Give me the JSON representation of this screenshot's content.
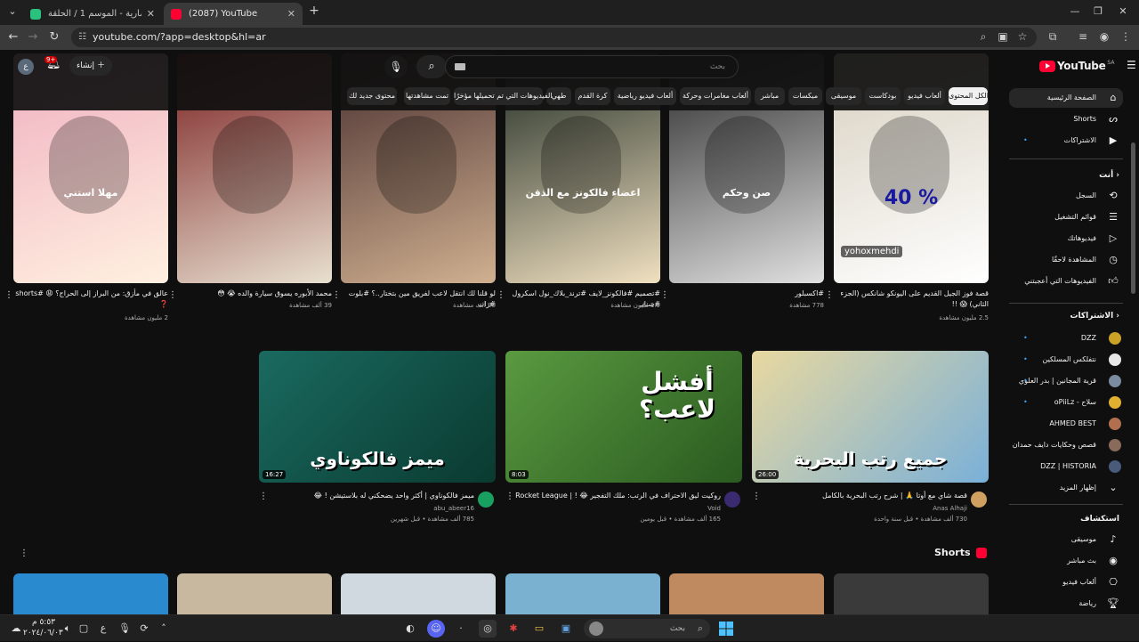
{
  "browser": {
    "tabs": [
      {
        "title": "شاهد الضارية - الموسم 1 / الحلقة",
        "active": false
      },
      {
        "title": "(2087) YouTube",
        "active": true
      }
    ],
    "new_tab": "+",
    "url": "youtube.com/?app=desktop&hl=ar"
  },
  "header": {
    "logo_text": "YouTube",
    "logo_region": "SA",
    "search_placeholder": "بحث",
    "create_label": "إنشاء",
    "notification_count": "9+",
    "avatar_letter": "ع"
  },
  "chips": [
    "الكل",
    "المحتوى",
    "ألعاب فيديو",
    "بودكاست",
    "موسيقى",
    "ميكسات",
    "مباشر",
    "ألعاب مغامرات وحركة",
    "ألعاب فيديو رياضية",
    "كرة القدم",
    "طهي",
    "الفيديوهات التي تم تحميلها مؤخرًا",
    "تمت مشاهدتها",
    "محتوى جديد لك"
  ],
  "sidebar": {
    "main": [
      {
        "label": "الصفحة الرئيسية",
        "icon": "home-icon"
      },
      {
        "label": "Shorts",
        "icon": "shorts-icon"
      },
      {
        "label": "الاشتراكات",
        "icon": "subscriptions-icon"
      }
    ],
    "you_header": "أنت",
    "you": [
      {
        "label": "السجل",
        "icon": "history-icon"
      },
      {
        "label": "قوائم التشغيل",
        "icon": "playlists-icon"
      },
      {
        "label": "فيديوهاتك",
        "icon": "your-videos-icon"
      },
      {
        "label": "المشاهدة لاحقًا",
        "icon": "watch-later-icon"
      },
      {
        "label": "الفيديوهات التي أعجبتني",
        "icon": "like-icon"
      }
    ],
    "subs_header": "الاشتراكات",
    "subs": [
      {
        "label": "DZZ",
        "color": "#c9a227"
      },
      {
        "label": "نتفلكس المسلكين",
        "color": "#e8e8e8"
      },
      {
        "label": "قرية المجانين | بدر العلوي",
        "color": "#7b8ba0"
      },
      {
        "label": "oPiiLz - سلاح",
        "color": "#e0b030"
      },
      {
        "label": "AHMED BEST",
        "color": "#b07050"
      },
      {
        "label": "قصص وحكايات دايف حمدان",
        "color": "#8a6a5a"
      },
      {
        "label": "DZZ | HISTORIA",
        "color": "#4a5a7a"
      }
    ],
    "show_more": "إظهار المزيد",
    "explore_header": "استكشاف",
    "explore": [
      {
        "label": "موسيقى",
        "icon": "music-icon"
      },
      {
        "label": "بث مباشر",
        "icon": "live-icon"
      },
      {
        "label": "ألعاب فيديو",
        "icon": "gaming-icon"
      },
      {
        "label": "رياضة",
        "icon": "trophy-icon"
      }
    ]
  },
  "row1": [
    {
      "title": "قصة فوز الجيل القديم على اليونكو شانكس (الجزء الثاني) 😱 !!",
      "views": "2.5 مليون مشاهدة",
      "overlay": "40 %",
      "handle": "yohoxmehdi",
      "colors": [
        "#d8d0c0",
        "#ffffff"
      ]
    },
    {
      "title": "#اكسبلور",
      "views": "778 مشاهدة",
      "overlay": "صن وحكم",
      "handle": "",
      "colors": [
        "#2a2a2a",
        "#e0e0e0"
      ]
    },
    {
      "title": "#تصميم #فالكونز_لايف #ترند_بلاك_نول اسكرول #سنابـ",
      "views": "1.9 مليون مشاهدة",
      "overlay": "اعضاء فالكونز مع الذقن",
      "handle": "",
      "colors": [
        "#1e2a22",
        "#f0e0c0"
      ]
    },
    {
      "title": "لو قلنا لك انتقل لاعب لفريق مين بتختار..؟ #بلوت #زات",
      "views": "90 ألف مشاهدة",
      "overlay": "",
      "handle": "",
      "colors": [
        "#4a3030",
        "#d0b090"
      ]
    },
    {
      "title": "محمد الأبوره يسوق سيارة والده 😭 😳",
      "views": "39 ألف مشاهدة",
      "overlay": "",
      "handle": "",
      "colors": [
        "#7a2020",
        "#e8e0d0"
      ]
    },
    {
      "title": "عالق في مأزق: من البراز إلى الحراج؟ 😩 #shorts ❓",
      "views": "2 مليون مشاهدة",
      "overlay": "مهلا استني",
      "handle": "",
      "colors": [
        "#f0b0c0",
        "#fff0e0"
      ]
    }
  ],
  "row2": [
    {
      "title": "قصة شاي مع أوتا 🙏 | شرح رتب البحرية بالكامل",
      "channel": "Anas Alhaji",
      "meta": "730 ألف مشاهدة • قبل سنة واحدة",
      "duration": "26:00",
      "overlay": "جميع رتب البحرية",
      "av": "#d0a060"
    },
    {
      "title": "روكيت ليق الاحتراف في الرتب: ملك التفجير 😂 ! | Rocket League",
      "channel": "Void",
      "meta": "165 ألف مشاهدة • قبل يومين",
      "duration": "8:03",
      "overlay": "أفشل لاعب؟",
      "av": "#3a2a70"
    },
    {
      "title": "ميمز فالكوناوي | أكثر واحد يضحكني له بلاستيشن ! 😂",
      "channel": "abu_abeer16",
      "meta": "785 ألف مشاهدة • قبل شهرين",
      "duration": "16:27",
      "overlay": "ميمز فالكوناوي",
      "av": "#18a060"
    }
  ],
  "shorts": {
    "title": "Shorts"
  },
  "taskbar": {
    "search": "بحث",
    "time": "٥:٥٣ م",
    "date": "٢٠٢٤/٠٦/٠٣",
    "lang": "ع"
  }
}
